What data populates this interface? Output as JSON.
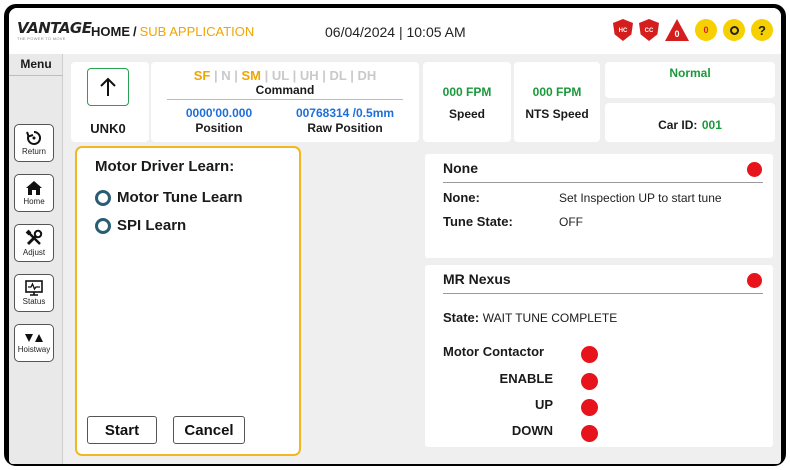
{
  "header": {
    "logo_text": "VANTAGE",
    "logo_tagline": "THE POWER TO MOVE",
    "breadcrumb_home": "HOME",
    "breadcrumb_sep": "/",
    "breadcrumb_sub": "SUB APPLICATION",
    "datetime": "06/04/2024 | 10:05 AM",
    "badges": {
      "hc": "HC",
      "cc": "CC",
      "warning_count": "0",
      "alarm_count": "0",
      "help": "?"
    }
  },
  "sidebar": {
    "title": "Menu",
    "items": [
      {
        "label": "Return",
        "icon": "return-icon"
      },
      {
        "label": "Home",
        "icon": "home-icon"
      },
      {
        "label": "Adjust",
        "icon": "tools-icon"
      },
      {
        "label": "Status",
        "icon": "monitor-icon"
      },
      {
        "label": "Hoistway",
        "icon": "hoistway-icon"
      }
    ]
  },
  "status": {
    "car_label": "UNK0",
    "command_flags": [
      "SF",
      "N",
      "SM",
      "UL",
      "UH",
      "DL",
      "DH"
    ],
    "command_flags_active": [
      "SF",
      "SM"
    ],
    "command_label": "Command",
    "position_value": "0000'00.000",
    "position_label": "Position",
    "raw_position_value": "00768314 /0.5mm",
    "raw_position_label": "Raw Position",
    "speed_value": "000 FPM",
    "speed_label": "Speed",
    "nts_speed_value": "000 FPM",
    "nts_speed_label": "NTS Speed",
    "mode": "Normal",
    "car_id_label": "Car ID:",
    "car_id_value": "001"
  },
  "learn_panel": {
    "title": "Motor Driver Learn:",
    "options": [
      "Motor Tune Learn",
      "SPI Learn"
    ],
    "start_label": "Start",
    "cancel_label": "Cancel"
  },
  "none_panel": {
    "title": "None",
    "rows": [
      {
        "key": "None:",
        "value": "Set Inspection UP to start tune"
      },
      {
        "key": "Tune State:",
        "value": "OFF"
      }
    ]
  },
  "nexus_panel": {
    "title": "MR Nexus",
    "state_key": "State:",
    "state_value": "WAIT TUNE COMPLETE",
    "contactor_label": "Motor Contactor",
    "signals": [
      "ENABLE",
      "UP",
      "DOWN"
    ]
  },
  "colors": {
    "accent": "#f0a500",
    "panel_border": "#f0b820",
    "alarm_red": "#e8141c",
    "value_blue": "#1e6fd9",
    "ok_green": "#1a9a3a"
  }
}
